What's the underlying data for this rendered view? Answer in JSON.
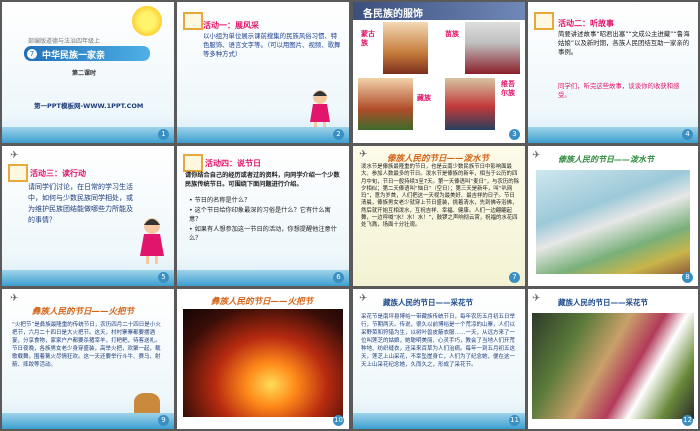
{
  "slides": [
    {
      "num": "1",
      "book": "部编版道德与法治四年级上",
      "lesson_no": "7",
      "lesson_title": "中华民族一家亲",
      "sub": "第二课时",
      "footer": "第一PPT模板网-WWW.1PPT.COM"
    },
    {
      "num": "2",
      "title": "活动一：展风采",
      "body": "以小组为单位展示课前搜集的民族风俗习惯、特色服饰、语言文字等。（可以用图片、视频、歌舞等多种方式）"
    },
    {
      "num": "3",
      "title": "各民族的服饰",
      "labels": [
        "蒙古族",
        "苗族",
        "藏族",
        "维吾尔族"
      ]
    },
    {
      "num": "4",
      "title": "活动二：听故事",
      "body": "简要讲述故事“昭君出塞”“文成公主进藏”“鲁海姑娘”以及新时期，各族人民团结互助一家亲的事例。",
      "closing": "同学们，听完这些故事，谈谈你的收获和感受。"
    },
    {
      "num": "5",
      "title": "活动三：读行动",
      "body": "请同学们讨论，在日常的学习生活中，如何与少数民族同学相处，或为维护民族团结能做哪些力所能及的事情？"
    },
    {
      "num": "6",
      "title": "活动四：说节日",
      "intro": "请你结合自己的经历或者过的资料，向同学介绍一个少数民族传统节日。可围绕下面问题进行介绍。",
      "q1": "节日的名称是什么？",
      "q2": "这个节日给你印象最深的习俗是什么？它有什么寓意？",
      "q3": "如果有人想参加这一节日的活动，你想提醒他注意什么？"
    },
    {
      "num": "7",
      "title": "傣族人民的节日——泼水节",
      "body": "泼水节是傣族最隆重的节日，也是云南少数民族节日中影响面最大、参加人数最多的节日。泼水节是傣族的新年，相当于公历的四月中旬，节日一般持续3至7天。第一天傣语叫“麦日”，与农历的除夕相似；第二天傣语叫“恼日”（空日）；第三天是新年，叫“叭网玛”，意为岁首，人们把这一天视为最美好、最吉祥的日子。节日清晨，傣族男女老少就穿上节日盛装，挑着清水，先到佛寺浴佛，然后就开始互相泼水，互祝吉祥、幸福、健康。人们一边翩翩起舞，一边呼喊“水！水！水！”，鼓锣之声响彻云霄，祝福的水花四处飞溅，场面十分壮观。"
    },
    {
      "num": "8",
      "title": "傣族人民的节日——泼水节"
    },
    {
      "num": "9",
      "title": "彝族人民的节日——火把节",
      "body": "“火把节”是彝族最隆重的传统节日，农历四月二十四日是小火把节，六月二十四日是大火把节。这天，村村寨寨都要摆酒宴，分享食物，家家户户都要杀猪宰羊，打粑粑，待客送礼。节日夜晚，各族男女老少身穿盛装，高举火把，欢聚一起，载歌载舞，围着篝火尽情狂欢。这一天还要举行斗牛、赛马、射箭、摔跤等活动。"
    },
    {
      "num": "10",
      "title": "彝族人民的节日——火把节"
    },
    {
      "num": "11",
      "title": "藏族人民的节日——采花节",
      "body": "采花节是南坪县博峪一带藏族传统节日，每年农历五月初五日举行，节期两天。传说，很久以前博峪是一个荒凉的山寨，人们以采野菜和狩猎为生，以树叶兽皮蔽衣服……一天，从远方来了一位叫莲芝的姑娘，她聪明美丽、心灵手巧，教会了当地人们开荒种地、纺织缝衣，还采来百草为人们治病。每年一到五月初五这天，莲芝上山采花，不幸坠崖身亡，人们为了纪念她，便在这一天上山采花纪念她，久而久之，形成了采花节。"
    },
    {
      "num": "12",
      "title": "藏族人民的节日——采花节"
    }
  ],
  "colors": {
    "accent": "#e0156b",
    "blue": "#3a8fc2",
    "orange": "#d4661a",
    "green": "#2f8d3f"
  }
}
